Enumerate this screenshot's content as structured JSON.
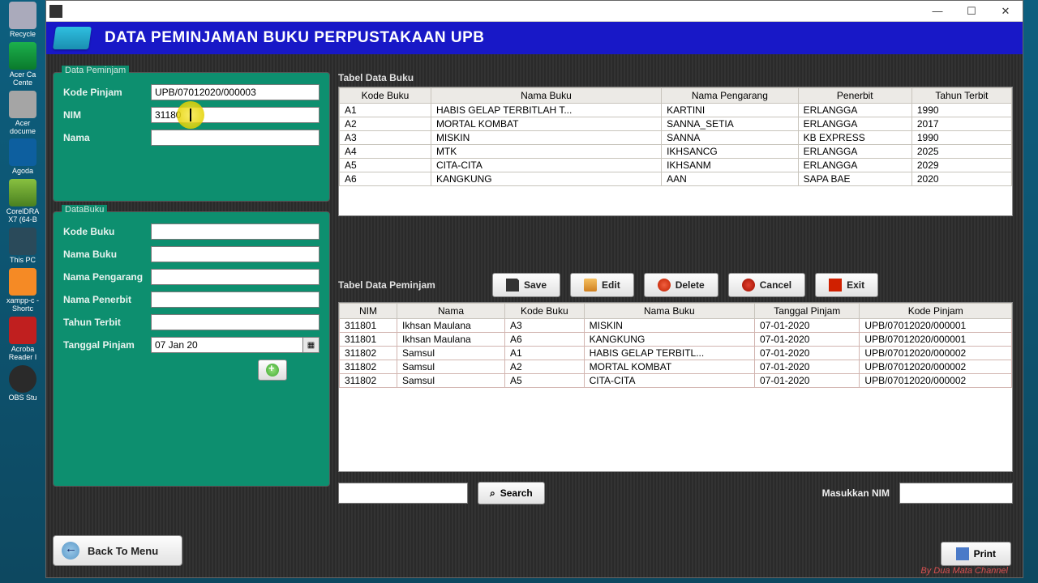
{
  "desktop_icons": [
    {
      "label": "Recycle",
      "cls": "bin"
    },
    {
      "label": "Acer Ca\nCente",
      "cls": "acer"
    },
    {
      "label": "Acer\ndocume",
      "cls": "pdf"
    },
    {
      "label": "Agoda",
      "cls": "agoda"
    },
    {
      "label": "CorelDRA\nX7 (64-B",
      "cls": "corel"
    },
    {
      "label": "This PC",
      "cls": "pc"
    },
    {
      "label": "xampp-c\n- Shortc",
      "cls": "xamp"
    },
    {
      "label": "Acroba\nReader I",
      "cls": "adobe"
    },
    {
      "label": "OBS Stu",
      "cls": "obs"
    }
  ],
  "window": {
    "title": ""
  },
  "header": {
    "title": "DATA PEMINJAMAN BUKU PERPUSTAKAAN UPB"
  },
  "panel_peminjam": {
    "legend": "Data Peminjam",
    "kode_pinjam_label": "Kode Pinjam",
    "kode_pinjam_value": "UPB/07012020/000003",
    "nim_label": "NIM",
    "nim_value": "31180",
    "nama_label": "Nama",
    "nama_value": ""
  },
  "panel_buku": {
    "legend": "DataBuku",
    "kode_buku_label": "Kode Buku",
    "nama_buku_label": "Nama Buku",
    "nama_pengarang_label": "Nama Pengarang",
    "nama_penerbit_label": "Nama Penerbit",
    "tahun_terbit_label": "Tahun Terbit",
    "tanggal_pinjam_label": "Tanggal Pinjam",
    "tanggal_pinjam_value": "07 Jan 20"
  },
  "back_button": "Back To Menu",
  "table_buku": {
    "title": "Tabel Data Buku",
    "headers": [
      "Kode Buku",
      "Nama Buku",
      "Nama Pengarang",
      "Penerbit",
      "Tahun Terbit"
    ],
    "rows": [
      [
        "A1",
        "HABIS GELAP TERBITLAH T...",
        "KARTINI",
        "ERLANGGA",
        "1990"
      ],
      [
        "A2",
        "MORTAL KOMBAT",
        "SANNA_SETIA",
        "ERLANGGA",
        "2017"
      ],
      [
        "A3",
        "MISKIN",
        "SANNA",
        "KB EXPRESS",
        "1990"
      ],
      [
        "A4",
        "MTK",
        "IKHSANCG",
        "ERLANGGA",
        "2025"
      ],
      [
        "A5",
        "CITA-CITA",
        "IKHSANM",
        "ERLANGGA",
        "2029"
      ],
      [
        "A6",
        "KANGKUNG",
        "AAN",
        "SAPA BAE",
        "2020"
      ]
    ]
  },
  "toolbar": {
    "save": "Save",
    "edit": "Edit",
    "delete": "Delete",
    "cancel": "Cancel",
    "exit": "Exit"
  },
  "table_peminjam": {
    "title": "Tabel Data Peminjam",
    "headers": [
      "NIM",
      "Nama",
      "Kode Buku",
      "Nama Buku",
      "Tanggal Pinjam",
      "Kode Pinjam"
    ],
    "rows": [
      [
        "311801",
        "Ikhsan Maulana",
        "A3",
        "MISKIN",
        "07-01-2020",
        "UPB/07012020/000001"
      ],
      [
        "311801",
        "Ikhsan Maulana",
        "A6",
        "KANGKUNG",
        "07-01-2020",
        "UPB/07012020/000001"
      ],
      [
        "311802",
        "Samsul",
        "A1",
        "HABIS GELAP TERBITL...",
        "07-01-2020",
        "UPB/07012020/000002"
      ],
      [
        "311802",
        "Samsul",
        "A2",
        "MORTAL KOMBAT",
        "07-01-2020",
        "UPB/07012020/000002"
      ],
      [
        "311802",
        "Samsul",
        "A5",
        "CITA-CITA",
        "07-01-2020",
        "UPB/07012020/000002"
      ]
    ]
  },
  "search": {
    "button": "Search",
    "nim_label": "Masukkan NIM"
  },
  "print_button": "Print",
  "footer": "By Dua Mata Channel"
}
